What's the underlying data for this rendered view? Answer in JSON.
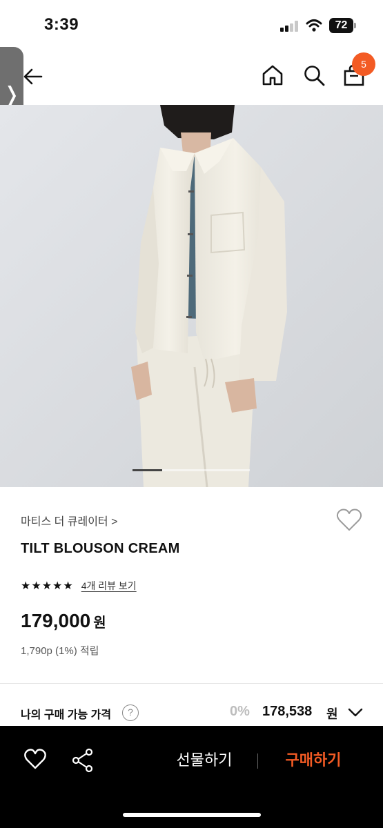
{
  "status_bar": {
    "time": "3:39",
    "battery": "72"
  },
  "header": {
    "icons": [
      "back-arrow-icon",
      "home-icon",
      "search-icon",
      "cart-icon"
    ],
    "cart_count": "5"
  },
  "side_handle": {
    "glyph": "❭"
  },
  "gallery": {
    "current_slide": 1,
    "position_fraction": 0.25
  },
  "product": {
    "brand": "마티스 더 큐레이터 >",
    "title": "TILT BLOUSON CREAM",
    "rating_stars": 5,
    "star_glyphs": [
      "★",
      "★",
      "★",
      "★",
      "★"
    ],
    "review_link": "4개 리뷰 보기",
    "price": "179,000",
    "price_unit": "원",
    "points": "1,790p (1%) 적립"
  },
  "my_price": {
    "label": "나의 구매 가능 가격",
    "help": "?",
    "discount": "0%",
    "price": "178,538",
    "unit": "원"
  },
  "bottom_bar": {
    "gift_label": "선물하기",
    "buy_label": "구매하기"
  },
  "colors": {
    "accent": "#f35b24",
    "bottom_bar": "#000000"
  }
}
